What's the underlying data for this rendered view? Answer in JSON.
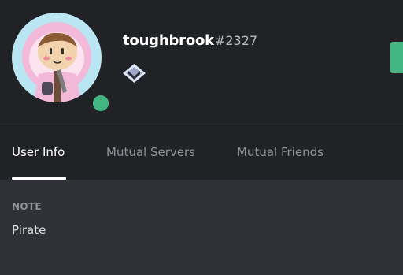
{
  "profile": {
    "username": "toughbrook",
    "discriminator": "#2327",
    "status": "online",
    "badge_icon": "hypesquad-badge-icon",
    "avatar_icon": "cartoon-avatar",
    "colors": {
      "status_online": "#43b581",
      "header_bg": "#202225",
      "body_bg": "#2f3136",
      "action_button": "#43b581"
    }
  },
  "tabs": [
    {
      "label": "User Info",
      "active": true
    },
    {
      "label": "Mutual Servers",
      "active": false
    },
    {
      "label": "Mutual Friends",
      "active": false
    }
  ],
  "note": {
    "label": "NOTE",
    "value": "Pirate"
  }
}
